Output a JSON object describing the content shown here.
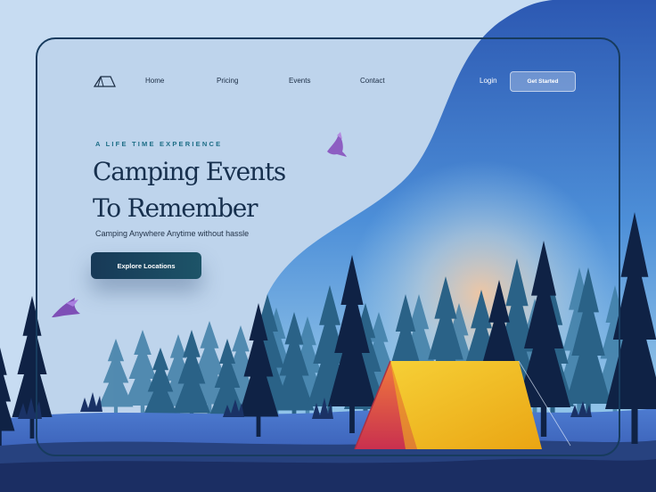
{
  "nav": {
    "logo_icon": "tent-logo-icon",
    "links": [
      "Home",
      "Pricing",
      "Events",
      "Contact"
    ],
    "login_label": "Login",
    "cta_label": "Get Started"
  },
  "hero": {
    "eyebrow": "A LIFE TIME EXPERIENCE",
    "title_line1": "Camping Events",
    "title_line2": "To Remember",
    "subtitle": "Camping Anywhere Anytime without hassle",
    "button_label": "Explore Locations"
  },
  "illustration": {
    "icons": [
      "bird-icon",
      "bird-icon",
      "tent-icon",
      "pine-tree-icon"
    ]
  },
  "colors": {
    "background": "#c7dcf2",
    "frame": "#173b5e",
    "title": "#17304e",
    "eyebrow": "#1d6d86",
    "button": "#173957",
    "sky_top": "#2f5fb8",
    "sky_glow": "#f0c8a3",
    "tent_yellow": "#f3bf1b",
    "tent_red": "#d8454e",
    "bird": "#8a5ec0"
  }
}
